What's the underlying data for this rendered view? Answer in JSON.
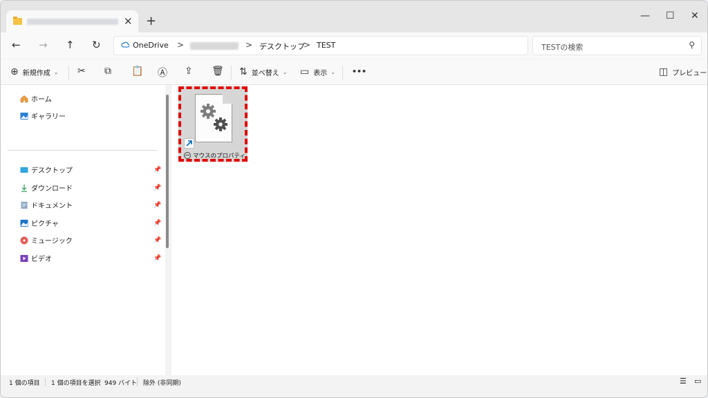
{
  "tab": {
    "title": "",
    "close": "✕",
    "new_tab": "+"
  },
  "window_controls": {
    "minimize": "—",
    "maximize": "☐",
    "close": "✕"
  },
  "nav": {
    "back": "←",
    "forward": "→",
    "up": "↑",
    "refresh": "↻"
  },
  "address": {
    "root": "OneDrive",
    "crumbs": [
      "デスクトップ",
      "TEST"
    ],
    "separator": ">"
  },
  "search": {
    "placeholder": "TESTの検索",
    "icon": "search-icon"
  },
  "commands": {
    "new": "新規作成",
    "sort": "並べ替え",
    "view": "表示",
    "more": "•••",
    "preview": "プレビュー"
  },
  "sidebar": {
    "top": [
      {
        "label": "ホーム",
        "icon": "home-icon"
      },
      {
        "label": "ギャラリー",
        "icon": "gallery-icon"
      }
    ],
    "pinned": [
      {
        "label": "デスクトップ",
        "icon": "desktop-icon"
      },
      {
        "label": "ダウンロード",
        "icon": "download-icon"
      },
      {
        "label": "ドキュメント",
        "icon": "document-icon"
      },
      {
        "label": "ピクチャ",
        "icon": "pictures-icon"
      },
      {
        "label": "ミュージック",
        "icon": "music-icon"
      },
      {
        "label": "ビデオ",
        "icon": "video-icon"
      }
    ]
  },
  "files": [
    {
      "name": "マウスのプロパティ",
      "type": "shortcut",
      "selected": true
    }
  ],
  "status": {
    "count": "1 個の項目",
    "selected": "1 個の項目を選択",
    "size": "949 バイト",
    "sync": "除外 (非同期)"
  },
  "colors": {
    "highlight": "#e00000",
    "accent": "#0067c0"
  }
}
